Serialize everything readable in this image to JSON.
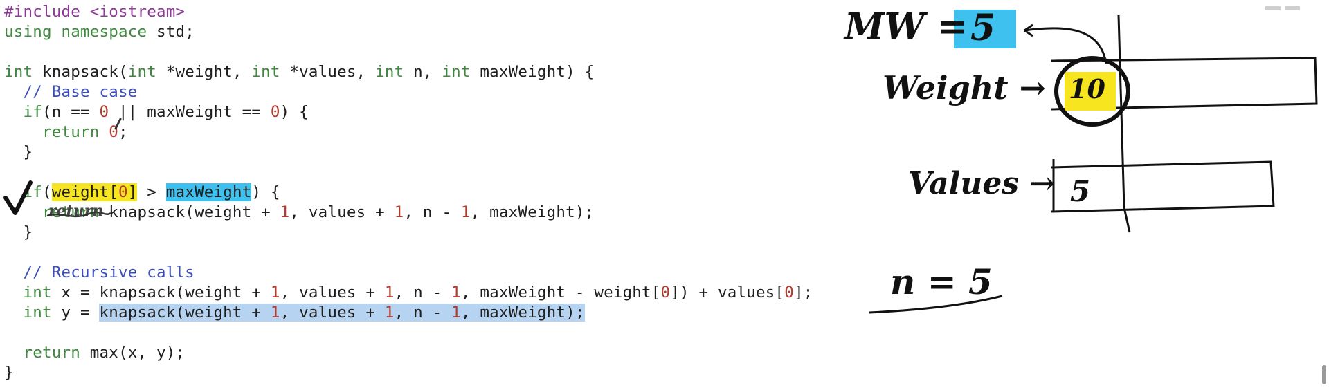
{
  "editor": {
    "lines": [
      {
        "tokens": [
          {
            "t": "pp",
            "v": "#include "
          },
          {
            "t": "ppstr",
            "v": "<iostream>"
          }
        ]
      },
      {
        "tokens": [
          {
            "t": "kw",
            "v": "using"
          },
          {
            "t": "txt",
            "v": " "
          },
          {
            "t": "kw",
            "v": "namespace"
          },
          {
            "t": "txt",
            "v": " std;"
          }
        ]
      },
      {
        "tokens": []
      },
      {
        "tokens": [
          {
            "t": "kw",
            "v": "int"
          },
          {
            "t": "txt",
            "v": " knapsack("
          },
          {
            "t": "kw",
            "v": "int"
          },
          {
            "t": "txt",
            "v": " *weight, "
          },
          {
            "t": "kw",
            "v": "int"
          },
          {
            "t": "txt",
            "v": " *values, "
          },
          {
            "t": "kw",
            "v": "int"
          },
          {
            "t": "txt",
            "v": " n, "
          },
          {
            "t": "kw",
            "v": "int"
          },
          {
            "t": "txt",
            "v": " maxWeight) {"
          }
        ]
      },
      {
        "tokens": [
          {
            "t": "txt",
            "v": "  "
          },
          {
            "t": "cm",
            "v": "// Base case"
          }
        ]
      },
      {
        "tokens": [
          {
            "t": "txt",
            "v": "  "
          },
          {
            "t": "kw",
            "v": "if"
          },
          {
            "t": "txt",
            "v": "(n == "
          },
          {
            "t": "num",
            "v": "0"
          },
          {
            "t": "txt",
            "v": " || maxWeight == "
          },
          {
            "t": "num",
            "v": "0"
          },
          {
            "t": "txt",
            "v": ") {"
          }
        ]
      },
      {
        "tokens": [
          {
            "t": "txt",
            "v": "    "
          },
          {
            "t": "kw",
            "v": "return"
          },
          {
            "t": "txt",
            "v": " "
          },
          {
            "t": "num",
            "v": "0"
          },
          {
            "t": "txt",
            "v": ";"
          }
        ]
      },
      {
        "tokens": [
          {
            "t": "txt",
            "v": "  }"
          }
        ]
      },
      {
        "tokens": []
      },
      {
        "tokens": [
          {
            "t": "txt",
            "v": "  "
          },
          {
            "t": "kw",
            "v": "if"
          },
          {
            "t": "txt",
            "v": "("
          },
          {
            "t": "txt",
            "v": "weight[",
            "hl": "yellow"
          },
          {
            "t": "num",
            "v": "0",
            "hl": "yellow"
          },
          {
            "t": "txt",
            "v": "]",
            "hl": "yellow"
          },
          {
            "t": "txt",
            "v": " > "
          },
          {
            "t": "txt",
            "v": "maxWeight",
            "hl": "blue"
          },
          {
            "t": "txt",
            "v": ") {"
          }
        ]
      },
      {
        "tokens": [
          {
            "t": "txt",
            "v": "    "
          },
          {
            "t": "kw",
            "v": "return"
          },
          {
            "t": "txt",
            "v": " knapsack(weight + "
          },
          {
            "t": "num",
            "v": "1"
          },
          {
            "t": "txt",
            "v": ", values + "
          },
          {
            "t": "num",
            "v": "1"
          },
          {
            "t": "txt",
            "v": ", n - "
          },
          {
            "t": "num",
            "v": "1"
          },
          {
            "t": "txt",
            "v": ", maxWeight);"
          }
        ]
      },
      {
        "tokens": [
          {
            "t": "txt",
            "v": "  }"
          }
        ]
      },
      {
        "tokens": []
      },
      {
        "tokens": [
          {
            "t": "txt",
            "v": "  "
          },
          {
            "t": "cm",
            "v": "// Recursive calls"
          }
        ]
      },
      {
        "tokens": [
          {
            "t": "txt",
            "v": "  "
          },
          {
            "t": "kw",
            "v": "int"
          },
          {
            "t": "txt",
            "v": " x = knapsack(weight + "
          },
          {
            "t": "num",
            "v": "1"
          },
          {
            "t": "txt",
            "v": ", values + "
          },
          {
            "t": "num",
            "v": "1"
          },
          {
            "t": "txt",
            "v": ", n - "
          },
          {
            "t": "num",
            "v": "1"
          },
          {
            "t": "txt",
            "v": ", maxWeight - weight["
          },
          {
            "t": "num",
            "v": "0"
          },
          {
            "t": "txt",
            "v": "]) + values["
          },
          {
            "t": "num",
            "v": "0"
          },
          {
            "t": "txt",
            "v": "];"
          }
        ]
      },
      {
        "tokens": [
          {
            "t": "txt",
            "v": "  "
          },
          {
            "t": "kw",
            "v": "int"
          },
          {
            "t": "txt",
            "v": " y = "
          },
          {
            "t": "txt",
            "v": "knapsack(weight + ",
            "hl": "sel"
          },
          {
            "t": "num",
            "v": "1",
            "hl": "sel"
          },
          {
            "t": "txt",
            "v": ", values + ",
            "hl": "sel"
          },
          {
            "t": "num",
            "v": "1",
            "hl": "sel"
          },
          {
            "t": "txt",
            "v": ", n - ",
            "hl": "sel"
          },
          {
            "t": "num",
            "v": "1",
            "hl": "sel"
          },
          {
            "t": "txt",
            "v": ", maxWeight);",
            "hl": "sel"
          }
        ]
      },
      {
        "tokens": []
      },
      {
        "tokens": [
          {
            "t": "txt",
            "v": "  "
          },
          {
            "t": "kw",
            "v": "return"
          },
          {
            "t": "txt",
            "v": " max(x, y);"
          }
        ]
      },
      {
        "tokens": [
          {
            "t": "txt",
            "v": "}"
          }
        ]
      }
    ]
  },
  "whiteboard": {
    "mw_label": "MW =",
    "mw_value": "5",
    "weight_label": "Weight →",
    "weight_value": "10",
    "values_label": "Values →",
    "values_value": "5",
    "n_label": "n = 5",
    "strike_note": "return"
  },
  "colors": {
    "keyword": "#3f8a3f",
    "number": "#b23b2d",
    "comment": "#3d4fb8",
    "preprocessor": "#8e3b98",
    "highlight_yellow": "#f6e51f",
    "highlight_blue": "#3ec1ee",
    "selection": "#b6d4f2"
  }
}
